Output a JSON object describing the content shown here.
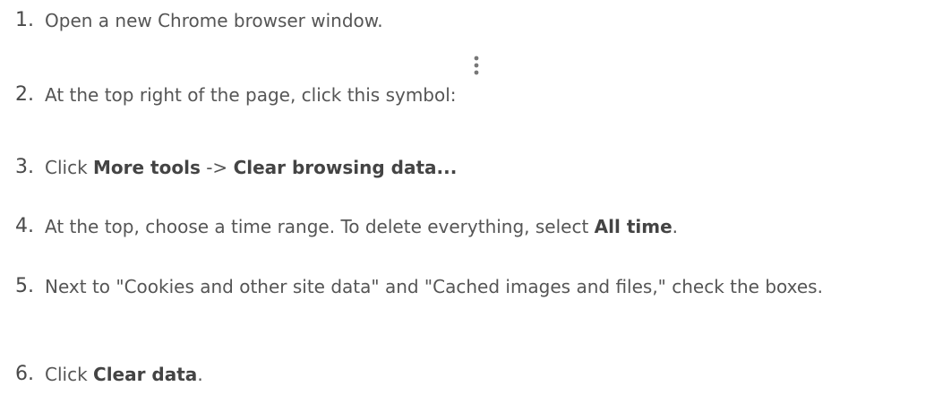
{
  "steps": [
    {
      "number": "1.",
      "parts": [
        {
          "text": "Open a new Chrome browser window.",
          "bold": false
        }
      ]
    },
    {
      "number": "2.",
      "parts": [
        {
          "text": "At the top right of the page, click this symbol:",
          "bold": false
        }
      ],
      "icon": "three-dot-menu-icon"
    },
    {
      "number": "3.",
      "parts": [
        {
          "text": "Click ",
          "bold": false
        },
        {
          "text": "More tools",
          "bold": true
        },
        {
          "text": " -> ",
          "bold": false
        },
        {
          "text": "Clear browsing data...",
          "bold": true
        }
      ]
    },
    {
      "number": "4.",
      "parts": [
        {
          "text": "At the top, choose a time range. To delete everything, select ",
          "bold": false
        },
        {
          "text": "All time",
          "bold": true
        },
        {
          "text": ".",
          "bold": false
        }
      ]
    },
    {
      "number": "5.",
      "parts": [
        {
          "text": "Next to \"Cookies and other site data\" and \"Cached images and files,\" check the boxes.",
          "bold": false
        }
      ]
    },
    {
      "number": "6.",
      "parts": [
        {
          "text": "Click ",
          "bold": false
        },
        {
          "text": "Clear data",
          "bold": true
        },
        {
          "text": ".",
          "bold": false
        }
      ]
    }
  ],
  "colors": {
    "text": "#555555",
    "icon": "#777777"
  }
}
